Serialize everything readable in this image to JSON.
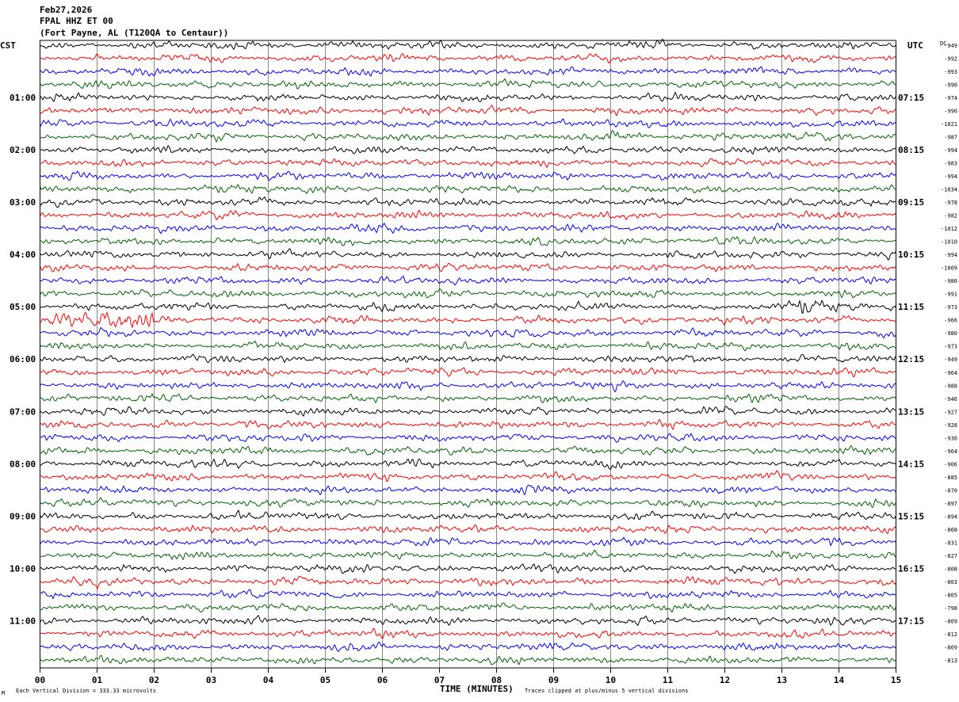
{
  "header": {
    "date": "Feb27,2026",
    "station": "FPAL HHZ ET 00",
    "location": "(Fort Payne, AL (T120QA to Centaur))"
  },
  "left_timezone": "CST",
  "right_timezone": "UTC",
  "dc_header": "DC",
  "footer": {
    "scale": "Each Vertical Division =  333.33 microvolts",
    "xlabel": "TIME (MINUTES)",
    "clip_note": "Traces clipped at plus/minus 5 vertical divisions",
    "corner_mark": "M"
  },
  "chart_data": {
    "type": "line",
    "xlabel": "TIME (MINUTES)",
    "xlim": [
      0,
      15
    ],
    "x_ticks": [
      "00",
      "01",
      "02",
      "03",
      "04",
      "05",
      "06",
      "07",
      "08",
      "09",
      "10",
      "11",
      "12",
      "13",
      "14",
      "15"
    ],
    "grid": "vertical lines each minute",
    "trace_colors": [
      "#000000",
      "#ff0000",
      "#0000ff",
      "#006400"
    ],
    "left_hour_labels": [
      "",
      "01:00",
      "02:00",
      "03:00",
      "04:00",
      "05:00",
      "06:00",
      "07:00",
      "08:00",
      "09:00",
      "10:00",
      "11:00"
    ],
    "right_hour_labels": [
      "",
      "07:15",
      "08:15",
      "09:15",
      "10:15",
      "11:15",
      "12:15",
      "13:15",
      "14:15",
      "15:15",
      "16:15",
      "17:15"
    ],
    "dc_offsets": [
      -949,
      -992,
      -993,
      -990,
      -974,
      -990,
      -1021,
      -987,
      -994,
      -983,
      -994,
      -1034,
      -978,
      -982,
      -1012,
      -1010,
      -994,
      -1009,
      -986,
      -991,
      -973,
      -966,
      -980,
      -973,
      -949,
      -964,
      -988,
      -946,
      -927,
      -928,
      -930,
      -964,
      -906,
      -885,
      -870,
      -897,
      -894,
      -868,
      -831,
      -827,
      -808,
      -803,
      -805,
      -798,
      -809,
      -812,
      -809,
      -813
    ],
    "notable_signals": [
      {
        "trace": 21,
        "minutes": [
          0,
          2
        ],
        "description": "elevated amplitude"
      },
      {
        "trace": 20,
        "minutes": [
          13.3,
          14.5
        ],
        "description": "short burst"
      }
    ]
  }
}
